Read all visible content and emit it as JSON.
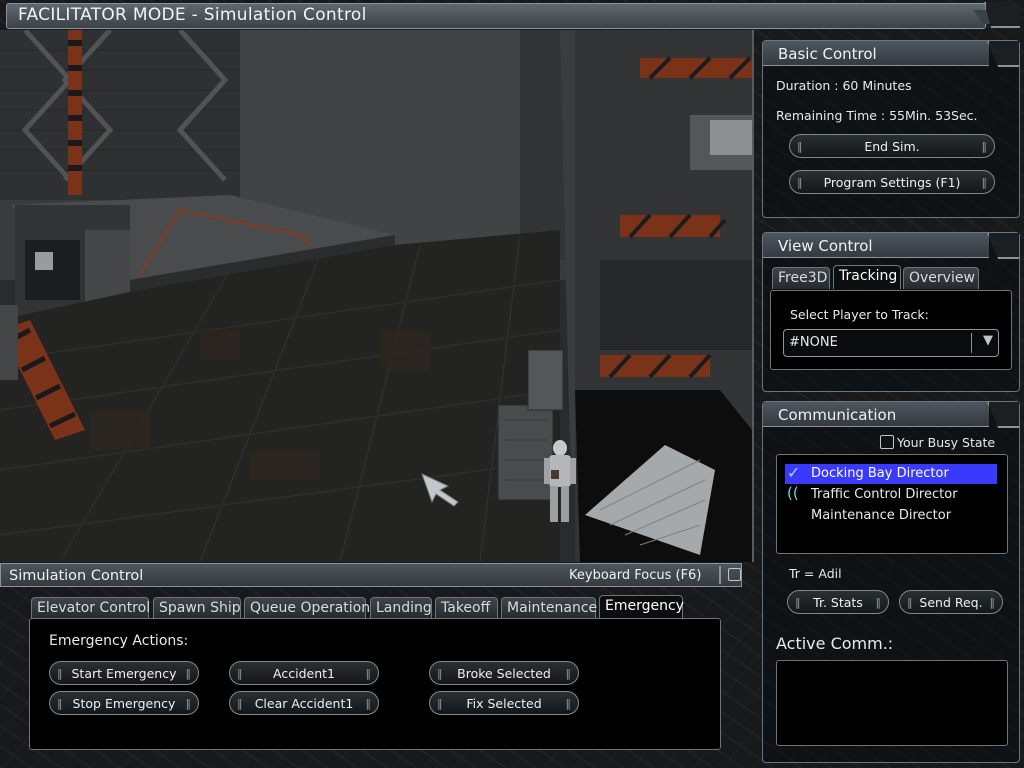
{
  "window": {
    "title": "FACILITATOR MODE - Simulation Control"
  },
  "basic_control": {
    "title": "Basic Control",
    "duration": "Duration : 60 Minutes",
    "remaining": "Remaining Time : 55Min. 53Sec.",
    "end_sim": "End Sim.",
    "program_settings": "Program Settings (F1)"
  },
  "view_control": {
    "title": "View Control",
    "tabs": [
      "Free3D",
      "Tracking",
      "Overview"
    ],
    "active_tab": "Tracking",
    "select_label": "Select Player to Track:",
    "selected_player": "#NONE"
  },
  "communication": {
    "title": "Communication",
    "busy_state_label": "Your Busy State",
    "busy_state_checked": false,
    "directors": [
      {
        "name": "Docking Bay Director",
        "selected": true,
        "icon": "checkmark-icon"
      },
      {
        "name": "Traffic Control Director",
        "selected": false,
        "icon": "signal-icon"
      },
      {
        "name": "Maintenance Director",
        "selected": false,
        "icon": ""
      }
    ],
    "tr_label": "Tr = Adil",
    "tr_stats": "Tr. Stats",
    "send_req": "Send Req.",
    "active_comm_label": "Active Comm.:",
    "active_comm_value": ""
  },
  "simulation_control": {
    "title": "Simulation Control",
    "keyboard_focus": "Keyboard Focus (F6)",
    "tabs": [
      "Elevator Control",
      "Spawn Ship",
      "Queue Operation",
      "Landing",
      "Takeoff",
      "Maintenance",
      "Emergency"
    ],
    "active_tab": "Emergency",
    "emergency": {
      "heading": "Emergency Actions:",
      "buttons": [
        "Start Emergency",
        "Stop Emergency",
        "Accident1",
        "Clear Accident1",
        "Broke Selected",
        "Fix Selected"
      ]
    }
  },
  "colors": {
    "accent_selected": "#3a3aff",
    "frame": "#6c757c",
    "hazard_orange": "#c0471b"
  }
}
